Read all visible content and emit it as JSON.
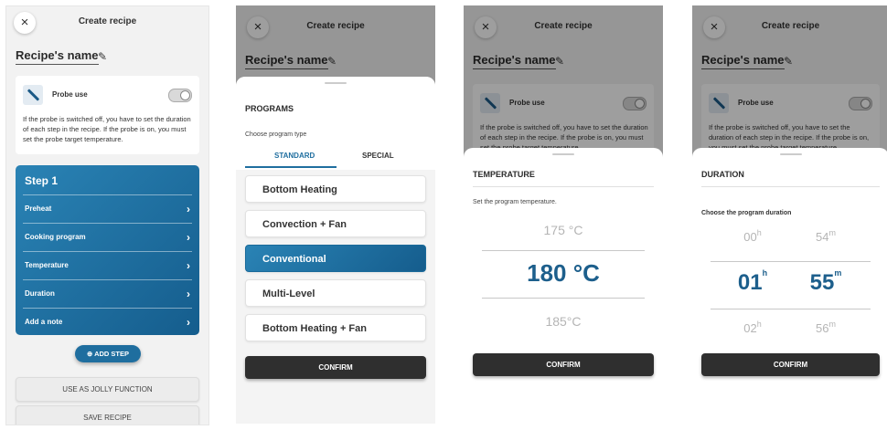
{
  "header": {
    "close_glyph": "×",
    "title": "Create recipe"
  },
  "recipe": {
    "name": "Recipe's name",
    "edit_icon": "pencil-icon"
  },
  "probe": {
    "label": "Probe use",
    "enabled": false,
    "description": "If the probe is switched off, you have to set the duration of each step in the recipe. If the probe is on, you must set the probe target temperature.",
    "description_cut": "If the probe is switched off, you have to set the duration of each step in the recipe. If the probe is on, you must set the probe target temperature."
  },
  "step": {
    "title": "Step 1",
    "rows": [
      "Preheat",
      "Cooking program",
      "Temperature",
      "Duration",
      "Add a note"
    ],
    "chevron": "›"
  },
  "actions": {
    "add_step": "ADD STEP",
    "add_icon": "⊕",
    "jolly": "USE AS JOLLY FUNCTION",
    "save": "SAVE RECIPE"
  },
  "programs": {
    "title": "PROGRAMS",
    "subtitle": "Choose program type",
    "tabs": [
      "STANDARD",
      "SPECIAL"
    ],
    "active_tab": "STANDARD",
    "items": [
      "Bottom Heating",
      "Convection + Fan",
      "Conventional",
      "Multi-Level",
      "Bottom Heating + Fan"
    ],
    "selected": "Conventional",
    "confirm": "CONFIRM"
  },
  "temperature": {
    "title": "TEMPERATURE",
    "subtitle": "Set the program temperature.",
    "above": "175 °C",
    "current": "180 °C",
    "below": "185°C",
    "confirm": "CONFIRM"
  },
  "duration": {
    "title": "DURATION",
    "subtitle": "Choose the program duration",
    "hours": {
      "above": "00",
      "current": "01",
      "below": "02",
      "unit": "h"
    },
    "minutes": {
      "above": "54",
      "current": "55",
      "below": "56",
      "unit": "m"
    },
    "confirm": "CONFIRM"
  },
  "colors": {
    "accent": "#1f6e9f",
    "accent_dark": "#155d8d",
    "confirm_bg": "#2f2f2f"
  }
}
